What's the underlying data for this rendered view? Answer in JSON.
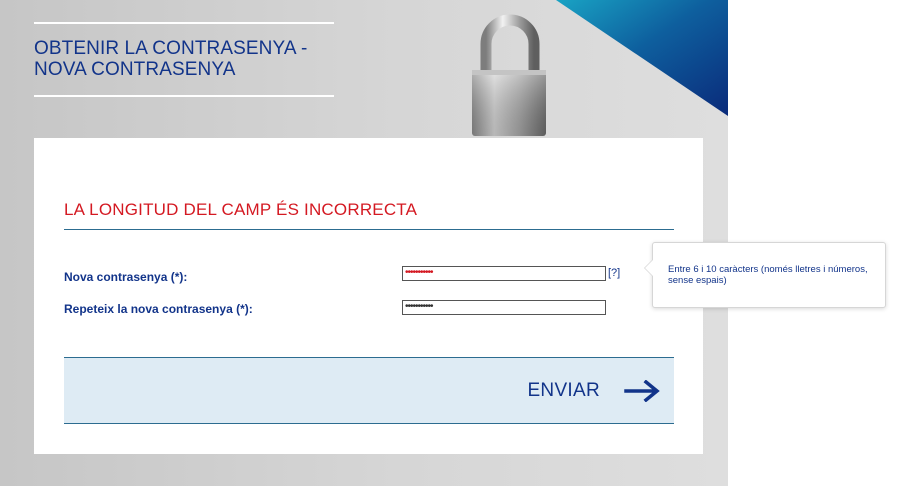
{
  "header": {
    "title_line1": "OBTENIR LA CONTRASENYA -",
    "title_line2": "NOVA CONTRASENYA"
  },
  "form": {
    "error_message": "LA LONGITUD DEL CAMP ÉS INCORRECTA",
    "new_password_label": "Nova contrasenya (*):",
    "new_password_value": "•••••••••••",
    "repeat_password_label": "Repeteix la nova contrasenya (*):",
    "repeat_password_value": "•••••••••••",
    "help_link": "[?]",
    "submit_label": "ENVIAR"
  },
  "tooltip": {
    "text": "Entre 6 i 10 caràcters (només lletres i números, sense espais)"
  },
  "icons": {
    "decor": "padlock-icon",
    "submit": "arrow-right-icon"
  },
  "colors": {
    "brand_blue": "#12348a",
    "error_red": "#d41922",
    "accent_teal": "#2c6c90",
    "submit_bg": "#deebf4"
  }
}
